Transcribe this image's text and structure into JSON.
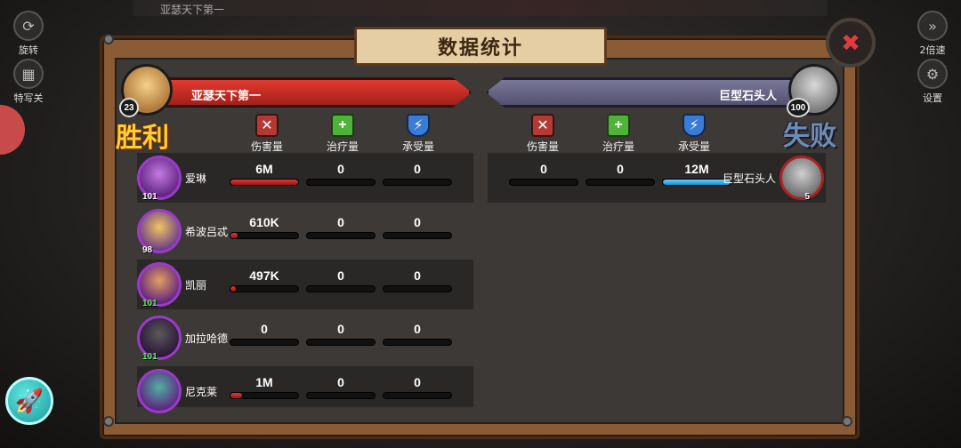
{
  "title": "数据统计",
  "close_icon": "close-icon",
  "background": {
    "top_bar_text": "亚瑟天下第一",
    "hud_left": [
      {
        "label": "旋转",
        "icon": "rotate-icon"
      },
      {
        "label": "特写关",
        "icon": "film-icon"
      }
    ],
    "hud_right": [
      {
        "label": "2倍速",
        "icon": "fast-forward-icon"
      },
      {
        "label": "设置",
        "icon": "gear-icon"
      }
    ]
  },
  "left_team": {
    "name": "亚瑟天下第一",
    "level": "23",
    "result": "胜利",
    "columns": [
      "伤害量",
      "治疗量",
      "承受量"
    ],
    "heroes": [
      {
        "name": "爱琳",
        "level": "101",
        "damage": "6M",
        "heal": "0",
        "taken": "0",
        "damage_fill": 1.0
      },
      {
        "name": "希波吕忒",
        "level": "98",
        "damage": "610K",
        "heal": "0",
        "taken": "0",
        "damage_fill": 0.1
      },
      {
        "name": "凯丽",
        "level": "101",
        "damage": "497K",
        "heal": "0",
        "taken": "0",
        "damage_fill": 0.08
      },
      {
        "name": "加拉哈德",
        "level": "101",
        "damage": "0",
        "heal": "0",
        "taken": "0",
        "damage_fill": 0
      },
      {
        "name": "尼克莱",
        "level": "",
        "damage": "1M",
        "heal": "0",
        "taken": "0",
        "damage_fill": 0.17
      }
    ]
  },
  "right_team": {
    "name": "巨型石头人",
    "level": "100",
    "result": "失败",
    "columns": [
      "伤害量",
      "治疗量",
      "承受量"
    ],
    "enemies": [
      {
        "name": "巨型石头人",
        "level": "5",
        "damage": "0",
        "heal": "0",
        "taken": "12M",
        "taken_fill": 1.0
      }
    ]
  },
  "colors": {
    "victory": "#ffcf2e",
    "defeat": "#6f8bb0",
    "damage_bar": "#e03a3a",
    "taken_bar": "#6ad0ff"
  }
}
